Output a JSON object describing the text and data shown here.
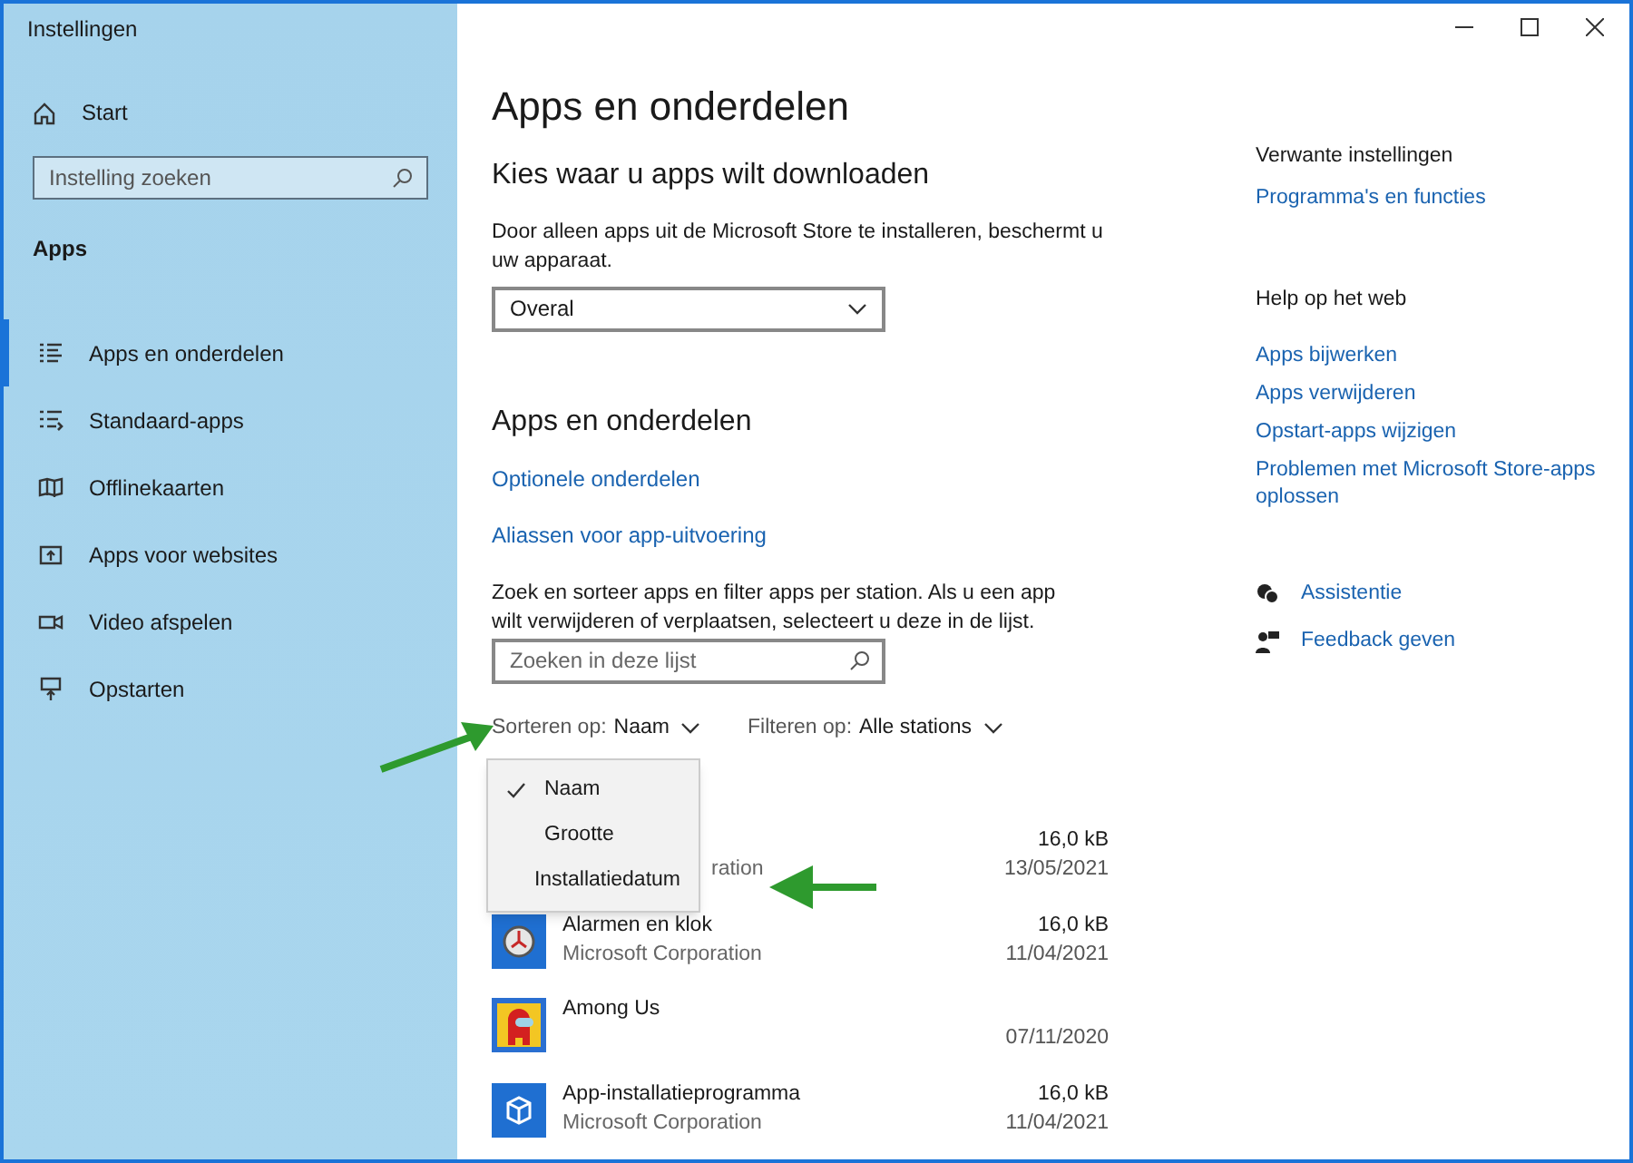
{
  "window": {
    "title": "Instellingen"
  },
  "sidebar": {
    "home": "Start",
    "search": {
      "placeholder": "Instelling zoeken"
    },
    "section": "Apps",
    "items": [
      {
        "label": "Apps en onderdelen",
        "kind": "list",
        "selected": true
      },
      {
        "label": "Standaard-apps",
        "kind": "defaults",
        "selected": false
      },
      {
        "label": "Offlinekaarten",
        "kind": "map",
        "selected": false
      },
      {
        "label": "Apps voor websites",
        "kind": "web",
        "selected": false
      },
      {
        "label": "Video afspelen",
        "kind": "video",
        "selected": false
      },
      {
        "label": "Opstarten",
        "kind": "startup",
        "selected": false
      }
    ]
  },
  "main": {
    "title": "Apps en onderdelen",
    "download": {
      "heading": "Kies waar u apps wilt downloaden",
      "description": "Door alleen apps uit de Microsoft Store te installeren, beschermt u uw apparaat.",
      "dropdown": "Overal"
    },
    "section": {
      "heading": "Apps en onderdelen",
      "links": [
        "Optionele onderdelen",
        "Aliassen voor app-uitvoering"
      ],
      "description": "Zoek en sorteer apps en filter apps per station. Als u een app wilt verwijderen of verplaatsen, selecteert u deze in de lijst.",
      "search": {
        "placeholder": "Zoeken in deze lijst"
      },
      "sort": {
        "label": "Sorteren op:",
        "value": "Naam"
      },
      "filter": {
        "label": "Filteren op:",
        "value": "Alle stations"
      },
      "sort_menu": [
        {
          "label": "Naam",
          "selected": true
        },
        {
          "label": "Grootte",
          "selected": false
        },
        {
          "label": "Installatiedatum",
          "selected": false
        }
      ],
      "apps": [
        {
          "kind": "hidden",
          "publisher": "ration",
          "size": "16,0 kB",
          "date": "13/05/2021"
        },
        {
          "kind": "clock",
          "name": "Alarmen en klok",
          "publisher": "Microsoft Corporation",
          "size": "16,0 kB",
          "date": "11/04/2021"
        },
        {
          "kind": "game",
          "name": "Among Us",
          "date": "07/11/2020"
        },
        {
          "kind": "package",
          "name": "App-installatieprogramma",
          "publisher": "Microsoft Corporation",
          "size": "16,0 kB",
          "date": "11/04/2021"
        }
      ]
    }
  },
  "related": {
    "heading": "Verwante instellingen",
    "links": [
      "Programma's en functies"
    ]
  },
  "help": {
    "heading": "Help op het web",
    "links": [
      "Apps bijwerken",
      "Apps verwijderen",
      "Opstart-apps wijzigen",
      "Problemen met Microsoft Store-apps oplossen"
    ]
  },
  "actions": [
    {
      "kind": "help",
      "label": "Assistentie"
    },
    {
      "kind": "feedback",
      "label": "Feedback geven"
    }
  ]
}
